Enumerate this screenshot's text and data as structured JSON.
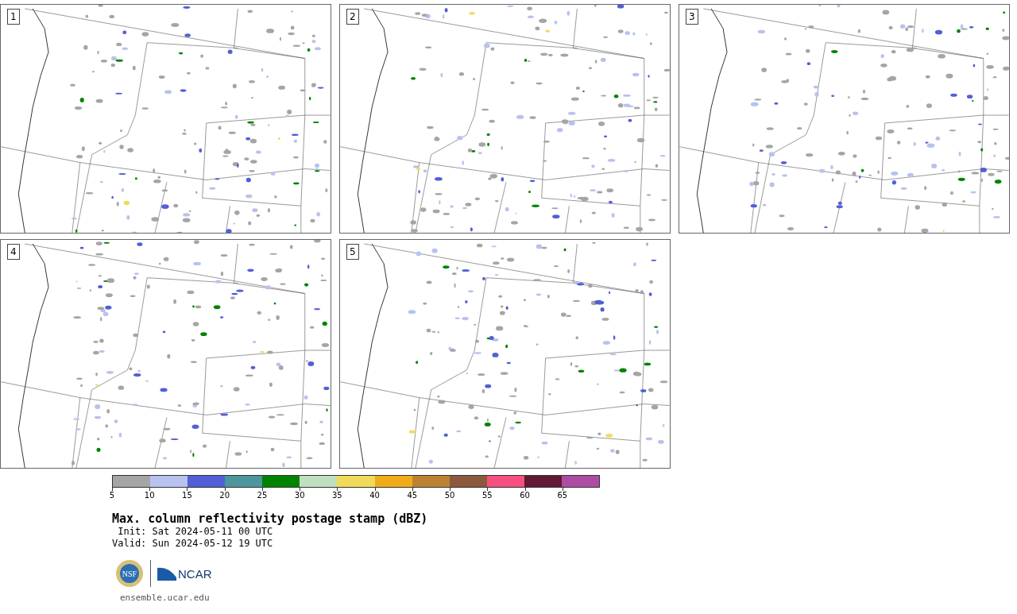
{
  "panels": [
    {
      "label": "1"
    },
    {
      "label": "2"
    },
    {
      "label": "3"
    },
    {
      "label": "4"
    },
    {
      "label": "5"
    }
  ],
  "colorbar": {
    "segments": [
      {
        "color": "#a5a5a5"
      },
      {
        "color": "#b8c2ee"
      },
      {
        "color": "#525fd6"
      },
      {
        "color": "#4e969e"
      },
      {
        "color": "#008400"
      },
      {
        "color": "#c0dfbf"
      },
      {
        "color": "#f0da5a"
      },
      {
        "color": "#f0ac18"
      },
      {
        "color": "#bd8231"
      },
      {
        "color": "#8b5a3e"
      },
      {
        "color": "#f5507f"
      },
      {
        "color": "#611935"
      },
      {
        "color": "#ac4da3"
      }
    ],
    "ticks": [
      "5",
      "10",
      "15",
      "20",
      "25",
      "30",
      "35",
      "40",
      "45",
      "50",
      "55",
      "60",
      "65"
    ]
  },
  "title": "Max. column reflectivity postage stamp (dBZ)",
  "init": " Init: Sat 2024-05-11 00 UTC",
  "valid": "Valid: Sun 2024-05-12 19 UTC",
  "logos": {
    "nsf": "NSF",
    "ncar": "NCAR"
  },
  "footer": "ensemble.ucar.edu"
}
